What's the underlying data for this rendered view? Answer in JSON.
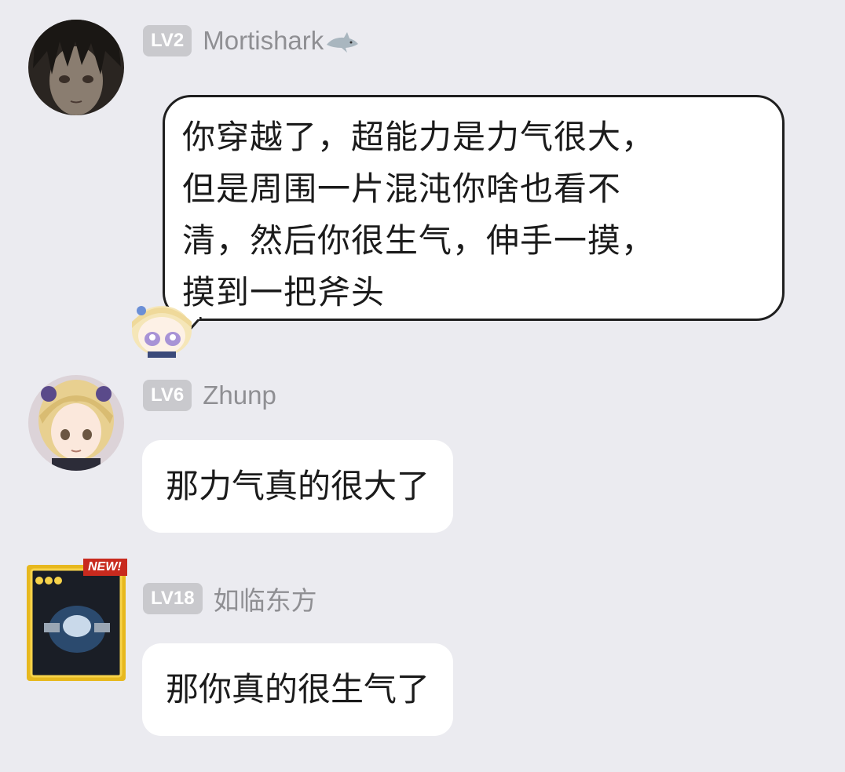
{
  "messages": [
    {
      "level": "LV2",
      "username": "Mortishark",
      "text": "你穿越了，超能力是力气很大，但是周围一片混沌你啥也看不清，然后你很生气，伸手一摸，摸到一把斧头",
      "lines": [
        "你穿越了，超能力是力气很大，",
        "但是周围一片混沌你啥也看不",
        "清，然后你很生气，伸手一摸，",
        "摸到一把斧头"
      ]
    },
    {
      "level": "LV6",
      "username": "Zhunp",
      "text": "那力气真的很大了"
    },
    {
      "level": "LV18",
      "username": "如临东方",
      "text": "那你真的很生气了",
      "avatar_badge": "NEW!"
    }
  ],
  "colors": {
    "background": "#ebebf0",
    "bubble": "#ffffff",
    "level_badge": "#c9c9cd",
    "username": "#8f8f93"
  }
}
